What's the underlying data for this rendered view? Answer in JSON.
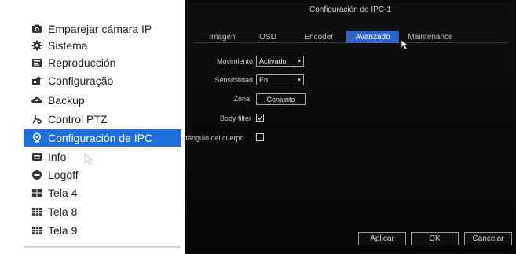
{
  "menu": {
    "items": [
      {
        "label": "Emparejar cámara IP",
        "icon": "camera-icon"
      },
      {
        "label": "Sistema",
        "icon": "gear-icon"
      },
      {
        "label": "Reproducción",
        "icon": "playback-icon"
      },
      {
        "label": "Configuração",
        "icon": "configuration-icon"
      },
      {
        "label": "Backup",
        "icon": "backup-icon"
      },
      {
        "label": "Control PTZ",
        "icon": "ptz-icon"
      },
      {
        "label": "Configuración de IPC",
        "icon": "ipc-config-icon",
        "selected": true
      },
      {
        "label": "Info",
        "icon": "info-icon"
      },
      {
        "label": "Logoff",
        "icon": "logoff-icon"
      },
      {
        "label": "Tela 4",
        "icon": "grid-4-icon"
      },
      {
        "label": "Tela 8",
        "icon": "grid-8-icon"
      },
      {
        "label": "Tela 9",
        "icon": "grid-9-icon"
      }
    ],
    "selected_color": "#1e6fd9"
  },
  "dialog": {
    "title": "Configuración de IPC-1",
    "tabs": [
      "Imagen",
      "OSD",
      "Encoder",
      "Avanzado",
      "Maintenance"
    ],
    "active_tab": "Avanzado",
    "accent_color": "#2f63c6",
    "fields": {
      "movement_label": "Movimiento",
      "movement_value": "Activado",
      "sensitivity_label": "Sensibilidad",
      "sensitivity_value": "En",
      "zone_label": "Zona",
      "zone_button": "Conjunto",
      "body_filter_label": "Body filter",
      "body_filter_checked": true,
      "body_rect_label": "ctángulo del cuerpo",
      "body_rect_checked": false
    },
    "buttons": {
      "apply": "Aplicar",
      "ok": "OK",
      "cancel": "Cancelar"
    }
  }
}
